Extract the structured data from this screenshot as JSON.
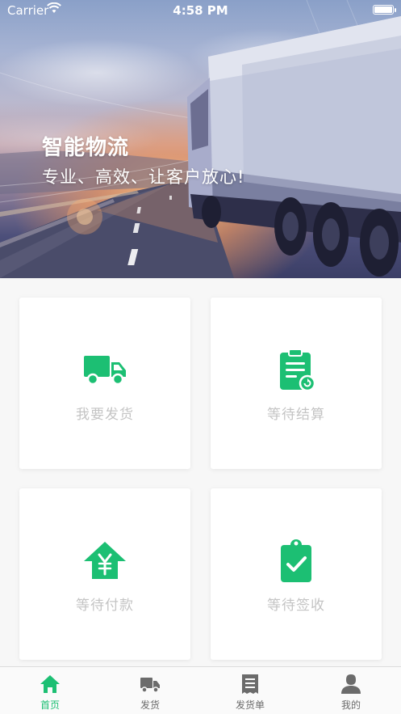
{
  "status_bar": {
    "carrier": "Carrier",
    "time": "4:58 PM"
  },
  "banner": {
    "headline": "智能物流",
    "tagline": "专业、高效、让客户放心!"
  },
  "cards": [
    {
      "label": "我要发货",
      "icon": "truck-icon"
    },
    {
      "label": "等待结算",
      "icon": "clipboard-refresh-icon"
    },
    {
      "label": "等待付款",
      "icon": "yen-house-icon"
    },
    {
      "label": "等待签收",
      "icon": "clipboard-check-icon"
    }
  ],
  "tabs": [
    {
      "label": "首页",
      "icon": "home-icon",
      "active": true
    },
    {
      "label": "发货",
      "icon": "truck-icon"
    },
    {
      "label": "发货单",
      "icon": "receipt-icon"
    },
    {
      "label": "我的",
      "icon": "user-icon"
    }
  ],
  "colors": {
    "accent": "#1cbf73",
    "card_label": "#c4c4c4",
    "tab_inactive": "#6b6b6b"
  }
}
